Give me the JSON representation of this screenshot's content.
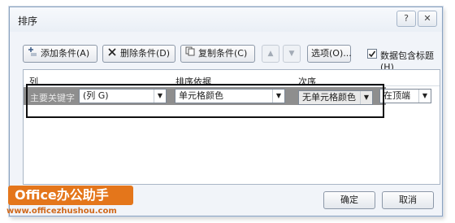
{
  "dialog": {
    "title": "排序",
    "help_label": "?",
    "close_label": "✕"
  },
  "toolbar": {
    "add_label": "添加条件(A)",
    "delete_label": "删除条件(D)",
    "copy_label": "复制条件(C)",
    "move_up_label": "▲",
    "move_down_label": "▼",
    "options_label": "选项(O)...",
    "header_checkbox_label": "数据包含标题(H)",
    "header_checkbox_checked": true
  },
  "table": {
    "columns": [
      "列",
      "排序依据",
      "次序"
    ],
    "rows": [
      {
        "key_label": "主要关键字",
        "column_value": "(列 G)",
        "sort_on_value": "单元格颜色",
        "order_value": "无单元格颜色",
        "position_value": "在顶端"
      }
    ]
  },
  "footer": {
    "ok_label": "确定",
    "cancel_label": "取消"
  },
  "watermark": {
    "brand": "Office办公助手",
    "url": "www.officezhushou.com"
  },
  "icons": {
    "add": "add-condition-icon",
    "delete": "delete-x-icon",
    "copy": "copy-icon",
    "dropdown": "chevron-down-icon",
    "check": "check-icon"
  },
  "colors": {
    "window_border": "#8aa2bf",
    "selected_row": "#8e8e8e",
    "brand_orange": "#e4761b"
  }
}
